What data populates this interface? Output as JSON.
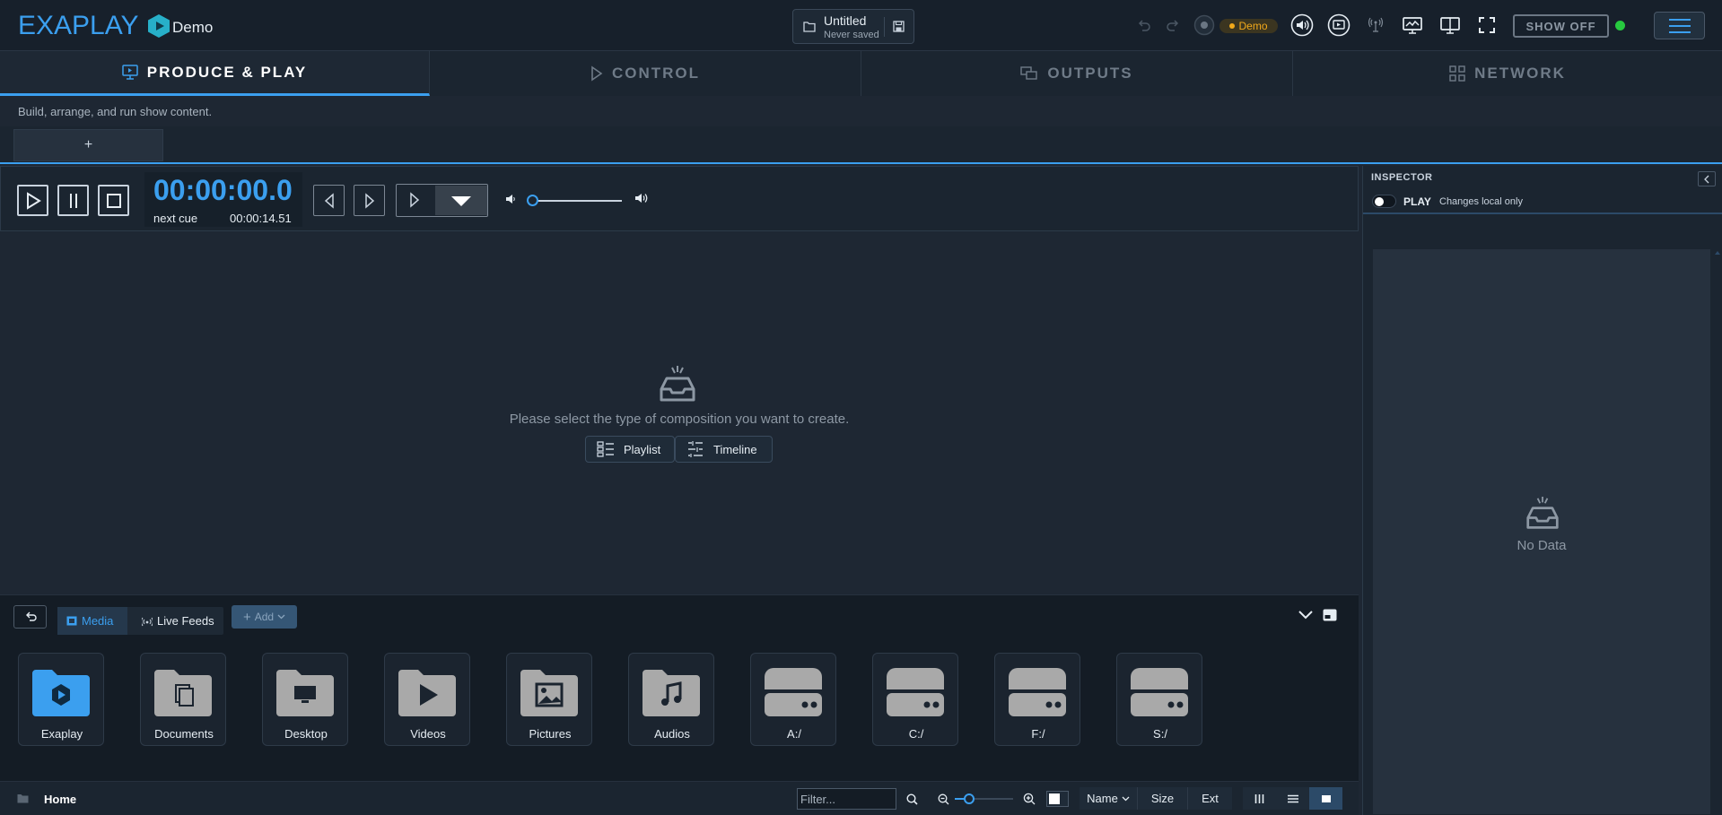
{
  "app": {
    "logo_text": "EXAPLAY",
    "edition": "Demo",
    "file_title": "Untitled",
    "file_status": "Never saved",
    "demo_badge": "Demo",
    "show_off": "SHOW OFF"
  },
  "icons": {
    "folder": "folder-icon",
    "save": "save-icon",
    "undo": "undo-icon",
    "redo": "redo-icon",
    "record": "record-icon",
    "audio": "audio-icon",
    "video": "video-icon",
    "broadcast": "broadcast-icon",
    "monitor": "monitor-icon",
    "split-screen": "split-screen-icon",
    "fullscreen": "fullscreen-icon",
    "menu": "hamburger-menu-icon"
  },
  "tabs": [
    {
      "label": "PRODUCE & PLAY",
      "icon": "presentation-icon",
      "active": true
    },
    {
      "label": "CONTROL",
      "icon": "play-triangle-icon",
      "active": false
    },
    {
      "label": "OUTPUTS",
      "icon": "outputs-icon",
      "active": false
    },
    {
      "label": "NETWORK",
      "icon": "grid-icon",
      "active": false
    }
  ],
  "subtitle": "Build, arrange, and run show content.",
  "add_tab_label": "+",
  "transport": {
    "time": "00:00:00.0",
    "next_label": "next cue",
    "next_time": "00:00:14.51",
    "volume": 0
  },
  "empty": {
    "message": "Please select the type of composition you want to create.",
    "playlist_label": "Playlist",
    "timeline_label": "Timeline"
  },
  "browser": {
    "tab_media": "Media",
    "tab_live": "Live Feeds",
    "add_label": "Add",
    "folders": [
      {
        "label": "Exaplay",
        "type": "exaplay"
      },
      {
        "label": "Documents",
        "type": "documents"
      },
      {
        "label": "Desktop",
        "type": "desktop"
      },
      {
        "label": "Videos",
        "type": "videos"
      },
      {
        "label": "Pictures",
        "type": "pictures"
      },
      {
        "label": "Audios",
        "type": "audios"
      },
      {
        "label": "A:/",
        "type": "drive"
      },
      {
        "label": "C:/",
        "type": "drive"
      },
      {
        "label": "F:/",
        "type": "drive"
      },
      {
        "label": "S:/",
        "type": "drive"
      }
    ]
  },
  "status": {
    "home": "Home",
    "filter_placeholder": "Filter...",
    "sort_name": "Name",
    "sort_size": "Size",
    "sort_ext": "Ext",
    "zoom_level": 0.2
  },
  "inspector": {
    "title": "INSPECTOR",
    "play_label": "PLAY",
    "changes_label": "Changes local only",
    "no_data": "No Data"
  },
  "colors": {
    "accent": "#3b9fef",
    "background": "#1e2733",
    "demo": "#f2a91a",
    "online": "#27c93f"
  }
}
